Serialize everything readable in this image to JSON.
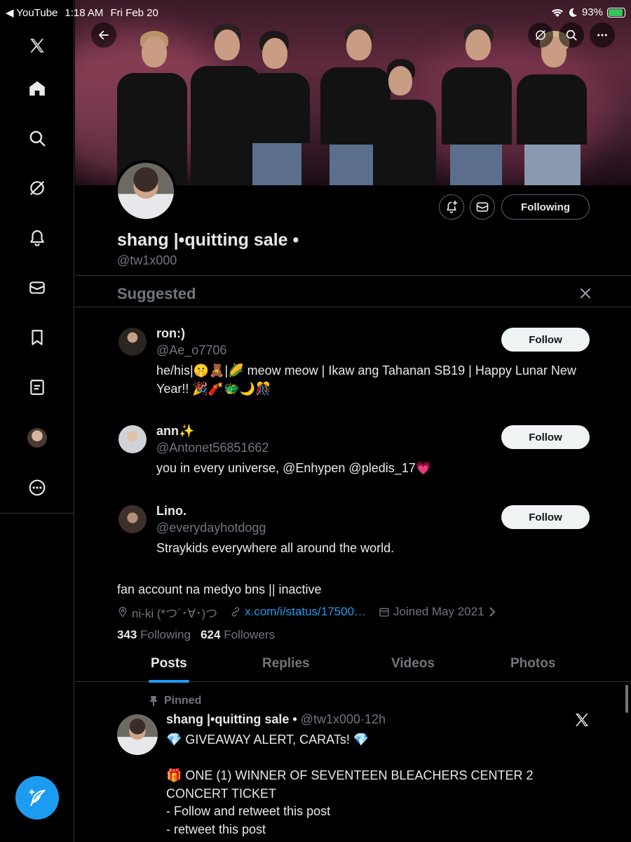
{
  "status_bar": {
    "back_app": "◀ YouTube",
    "time": "1:18 AM",
    "date": "Fri Feb 20",
    "battery": "93%",
    "battery_level": 0.93
  },
  "sidebar": {
    "items": [
      {
        "name": "x-logo-icon"
      },
      {
        "name": "home-icon"
      },
      {
        "name": "search-icon"
      },
      {
        "name": "grok-icon"
      },
      {
        "name": "notifications-bell-icon"
      },
      {
        "name": "messages-envelope-icon"
      },
      {
        "name": "bookmarks-icon"
      },
      {
        "name": "lists-icon"
      },
      {
        "name": "profile-avatar-icon"
      },
      {
        "name": "more-icon"
      }
    ],
    "compose_icon": "compose-feather-icon"
  },
  "profile": {
    "display_name": "shang |•quitting sale •",
    "handle": "@tw1x000",
    "following_button": "Following",
    "bio": "fan account na medyo bns || inactive",
    "location": "ni-ki (*つ´･∀･)つ",
    "link": "x.com/i/status/17500…",
    "joined": "Joined May 2021",
    "following_count": "343",
    "following_label": "Following",
    "followers_count": "624",
    "followers_label": "Followers"
  },
  "suggested": {
    "title": "Suggested",
    "follow_label": "Follow",
    "accounts": [
      {
        "name": "ron:)",
        "handle": "@Ae_o7706",
        "bio": "he/his|🤫🧸|🌽 meow meow | Ikaw ang Tahanan SB19 | Happy Lunar New Year!! 🎉🧨🐲🌙🎊"
      },
      {
        "name": "ann✨",
        "handle": "@Antonet56851662",
        "bio": "you in every universe, @Enhypen @pledis_17💗"
      },
      {
        "name": "Lino.",
        "handle": "@everydayhotdogg",
        "bio": "Straykids everywhere all around the world."
      }
    ]
  },
  "tabs": [
    "Posts",
    "Replies",
    "Videos",
    "Photos"
  ],
  "pinned_post": {
    "pinned_label": "Pinned",
    "author_name": "shang |•quitting sale •",
    "author_handle": "@tw1x000",
    "time": "·12h",
    "body": "💎 GIVEAWAY ALERT, CARATs! 💎\n\n🎁 ONE (1) WINNER OF SEVENTEEN BLEACHERS CENTER 2 CONCERT TICKET\n- Follow and retweet this post\n- retweet this post"
  },
  "colors": {
    "accent": "#1d9bf0",
    "background": "#000000",
    "secondary_text": "#71767b",
    "primary_text": "#e7e9ea",
    "border": "#2f3336"
  }
}
